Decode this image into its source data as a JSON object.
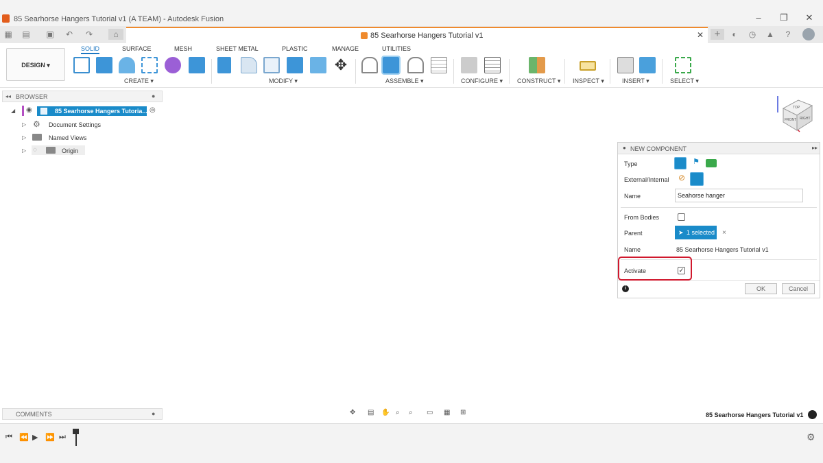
{
  "window": {
    "title": "85 Searhorse Hangers Tutorial v1 (A TEAM) - Autodesk Fusion",
    "minimize": "–",
    "maximize": "❐",
    "close": "✕"
  },
  "doc_tab": {
    "label": "85 Searhorse Hangers Tutorial v1",
    "close": "✕"
  },
  "workspace": "DESIGN ▾",
  "ribbon": {
    "tabs": [
      "SOLID",
      "SURFACE",
      "MESH",
      "SHEET METAL",
      "PLASTIC",
      "MANAGE",
      "UTILITIES"
    ],
    "groups": [
      "CREATE ▾",
      "MODIFY ▾",
      "ASSEMBLE ▾",
      "CONFIGURE ▾",
      "CONSTRUCT ▾",
      "INSPECT ▾",
      "INSERT ▾",
      "SELECT ▾"
    ]
  },
  "browser": {
    "title": "BROWSER",
    "root": "85 Searhorse Hangers Tutoria...",
    "items": [
      "Document Settings",
      "Named Views",
      "Origin"
    ]
  },
  "new_component": {
    "title": "NEW COMPONENT",
    "type_label": "Type",
    "ext_label": "External/Internal",
    "name_label": "Name",
    "name_value": "Seahorse hanger",
    "from_bodies_label": "From Bodies",
    "parent_label": "Parent",
    "parent_value": "1 selected",
    "parent_name_label": "Name",
    "parent_name_value": "85 Searhorse Hangers Tutorial v1",
    "activate_label": "Activate",
    "activate_checked": true,
    "ok": "OK",
    "cancel": "Cancel"
  },
  "comments": {
    "title": "COMMENTS"
  },
  "status_doc_name": "85 Searhorse Hangers Tutorial v1",
  "viewcube": {
    "top": "TOP",
    "front": "FRONT",
    "right": "RIGHT"
  },
  "colors": {
    "accent": "#1a8bc9",
    "highlight": "#d0182d",
    "tab_active": "#1a76c2"
  }
}
